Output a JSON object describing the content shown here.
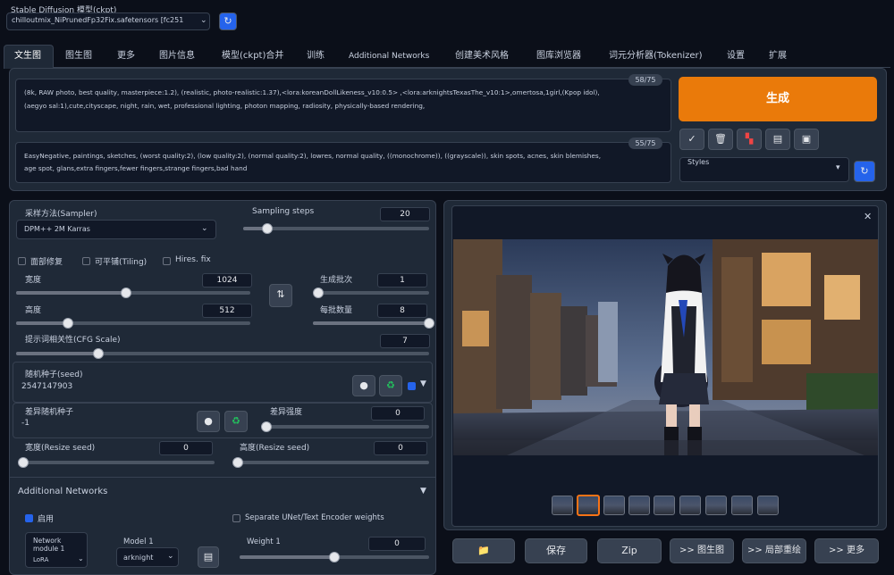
{
  "checkpoint": {
    "label": "Stable Diffusion 模型(ckpt)",
    "value": "chilloutmix_NiPrunedFp32Fix.safetensors [fc251"
  },
  "tabs": [
    "文生图",
    "图生图",
    "更多",
    "图片信息",
    "模型(ckpt)合并",
    "训练",
    "Additional Networks",
    "创建美术风格",
    "图库浏览器",
    "词元分析器(Tokenizer)",
    "设置",
    "扩展"
  ],
  "prompt": {
    "counter": "58/75",
    "line1": "(8k, RAW photo, best quality, masterpiece:1.2), (realistic, photo-realistic:1.37),<lora:koreanDollLikeness_v10:0.5> ,<lora:arknightsTexasThe_v10:1>,omertosa,1girl,(Kpop idol),",
    "line2": "(aegyo sal:1),cute,cityscape, night, rain, wet, professional lighting, photon mapping, radiosity, physically-based rendering,"
  },
  "negative": {
    "counter": "55/75",
    "line1": "EasyNegative, paintings, sketches, (worst quality:2), (low quality:2), (normal quality:2), lowres, normal quality, ((monochrome)), ((grayscale)), skin spots, acnes, skin blemishes,",
    "line2": "age spot, glans,extra fingers,fewer fingers,strange fingers,bad hand"
  },
  "generate_label": "生成",
  "styles_label": "Styles",
  "sampler": {
    "label": "采样方法(Sampler)",
    "value": "DPM++ 2M Karras"
  },
  "steps": {
    "label": "Sampling steps",
    "value": "20",
    "fraction": 0.13
  },
  "checks": {
    "face": "面部修复",
    "tiling": "可平铺(Tiling)",
    "hires": "Hires. fix"
  },
  "width": {
    "label": "宽度",
    "value": "1024",
    "fraction": 0.47
  },
  "height": {
    "label": "高度",
    "value": "512",
    "fraction": 0.22
  },
  "batch_count": {
    "label": "生成批次",
    "value": "1",
    "fraction": 0.0
  },
  "batch_size": {
    "label": "每批数量",
    "value": "8",
    "fraction": 1.0
  },
  "cfg": {
    "label": "提示词相关性(CFG Scale)",
    "value": "7",
    "fraction": 0.2
  },
  "seed": {
    "label": "随机种子(seed)",
    "value": "2547147903"
  },
  "var_seed": {
    "label": "差异随机种子",
    "value": "-1"
  },
  "var_strength": {
    "label": "差异强度",
    "value": "0",
    "fraction": 0.0
  },
  "resize_w": {
    "label": "宽度(Resize seed)",
    "value": "0",
    "fraction": 0.0
  },
  "resize_h": {
    "label": "高度(Resize seed)",
    "value": "0",
    "fraction": 0.0
  },
  "addnet": {
    "title": "Additional Networks",
    "enable": "启用",
    "separate": "Separate UNet/Text Encoder weights",
    "module_label": "Network module 1",
    "module_value": "LoRA",
    "model_label": "Model 1",
    "model_value": "arknight",
    "weight_label": "Weight 1",
    "weight_value": "0",
    "weight_fraction": 0.5
  },
  "output_buttons": {
    "folder": "📁",
    "save": "保存",
    "zip": "Zip",
    "img2img": ">> 图生图",
    "inpaint": ">> 局部重绘",
    "extras": ">> 更多"
  },
  "colors": {
    "accent": "#ea7a0a",
    "bg": "#0b0f19",
    "panel": "#1f2937"
  }
}
